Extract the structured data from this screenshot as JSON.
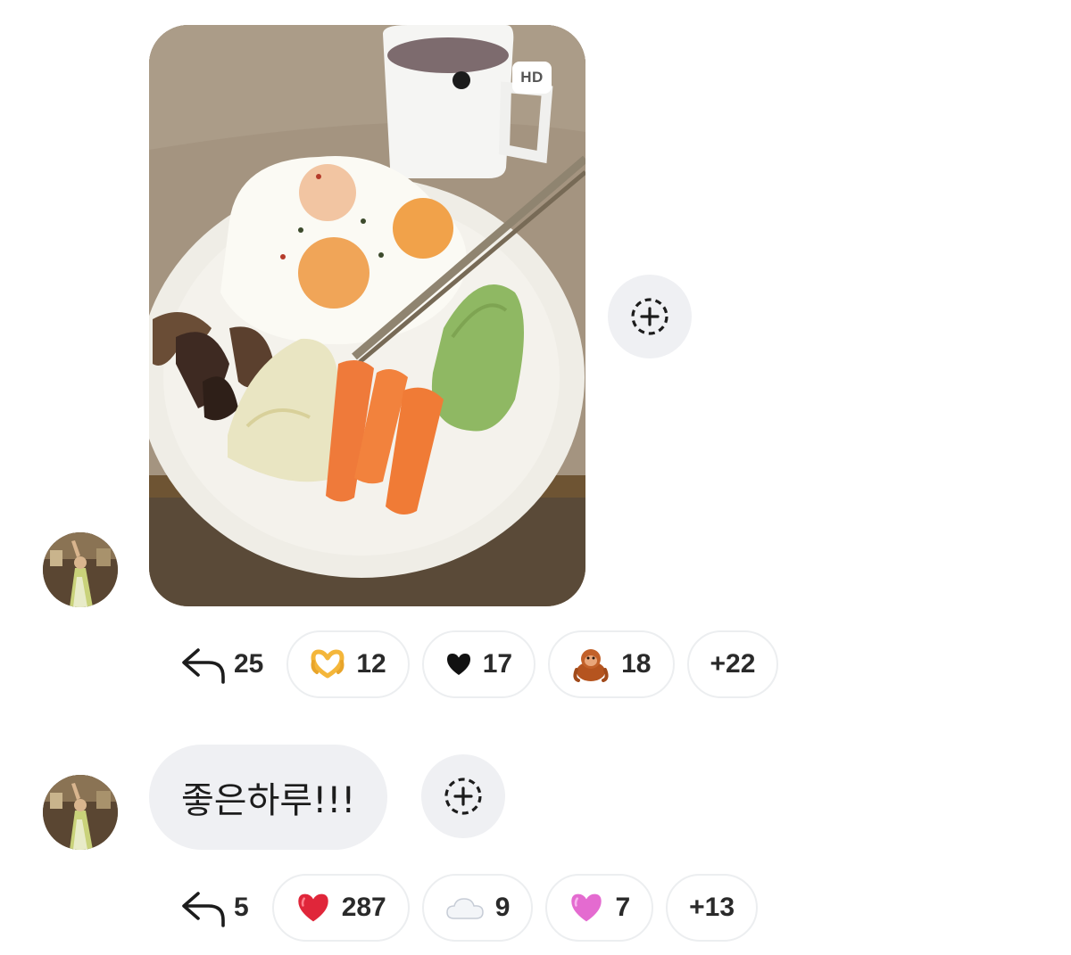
{
  "messages": [
    {
      "type": "photo",
      "badge": "HD",
      "replies": "25",
      "reactions": [
        {
          "icon": "heart-hands-icon",
          "glyph": "🫶",
          "count": "12"
        },
        {
          "icon": "black-heart-icon",
          "glyph": "♥",
          "count": "17"
        },
        {
          "icon": "orangutan-icon",
          "glyph": "🦧",
          "count": "18"
        },
        {
          "icon": "more-reactions",
          "glyph": "",
          "count": "+22"
        }
      ]
    },
    {
      "type": "text",
      "text": "좋은하루!!!",
      "replies": "5",
      "reactions": [
        {
          "icon": "red-heart-icon",
          "glyph": "❤",
          "count": "287"
        },
        {
          "icon": "cloud-icon",
          "glyph": "☁",
          "count": "9"
        },
        {
          "icon": "pink-heart-icon",
          "glyph": "♥",
          "count": "7"
        },
        {
          "icon": "more-reactions",
          "glyph": "",
          "count": "+13"
        }
      ]
    }
  ],
  "colors": {
    "bubble_bg": "#eff0f3",
    "red_heart": "#e0263a",
    "pink_heart": "#e46bd0",
    "text": "#2a2a2a"
  }
}
